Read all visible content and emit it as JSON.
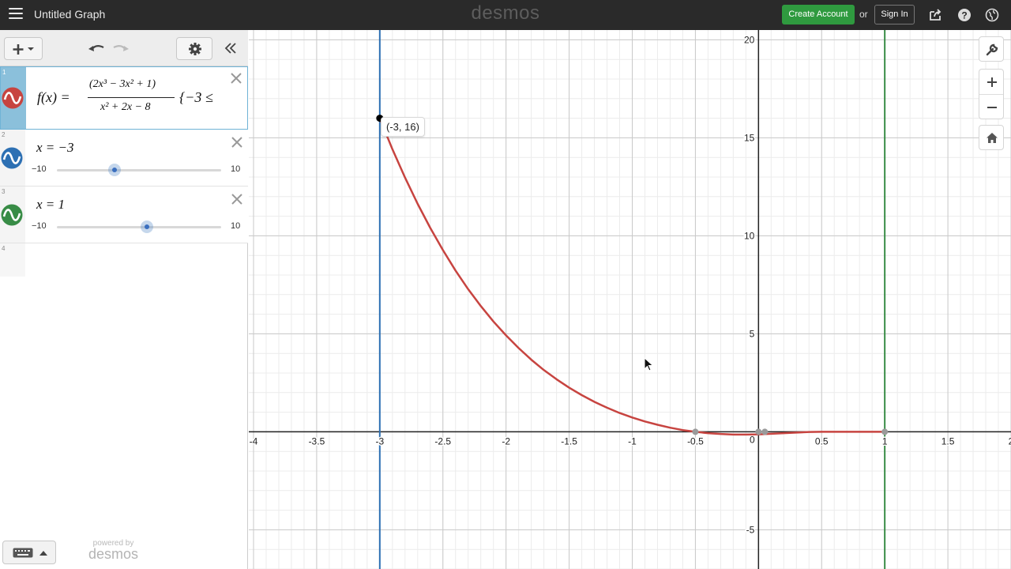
{
  "header": {
    "title": "Untitled Graph",
    "brand": "desmos",
    "create_account_label": "Create Account",
    "or_label": "or",
    "sign_in_label": "Sign In"
  },
  "expressions": [
    {
      "number": "1",
      "color": "#c74440",
      "latex_text": "f(x) = (2x³ − 3x² + 1) / (x² + 2x − 8) {−3 ≤",
      "fn_name": "f(x) =",
      "numerator": "(2x³ − 3x² + 1)",
      "denominator": "x² + 2x − 8",
      "restriction": "{−3 ≤"
    },
    {
      "number": "2",
      "color": "#2d70b3",
      "text": "x = −3",
      "slider": {
        "min_label": "−10",
        "max_label": "10",
        "min": -10,
        "max": 10,
        "value": -3
      }
    },
    {
      "number": "3",
      "color": "#388c46",
      "text": "x = 1",
      "slider": {
        "min_label": "−10",
        "max_label": "10",
        "min": -10,
        "max": 10,
        "value": 1
      }
    },
    {
      "number": "4"
    }
  ],
  "footer": {
    "powered_by": "powered by",
    "powered_brand": "desmos"
  },
  "point_label": "(-3, 16)",
  "chart_data": {
    "type": "line",
    "xlim": [
      -4,
      2
    ],
    "ylim": [
      -7,
      20.5
    ],
    "grid": true,
    "x_ticks": [
      -4,
      -3.5,
      -3,
      -2.5,
      -2,
      -1.5,
      -1,
      -0.5,
      0,
      0.5,
      1,
      1.5,
      2
    ],
    "x_tick_labels": [
      "-4",
      "-3.5",
      "-3",
      "-2.5",
      "-2",
      "-1.5",
      "-1",
      "-0.5",
      "0",
      "0.5",
      "1",
      "1.5",
      "2"
    ],
    "y_ticks": [
      -5,
      5,
      10,
      15,
      20
    ],
    "y_tick_labels": [
      "-5",
      "5",
      "10",
      "15",
      "20"
    ],
    "series": [
      {
        "color": "#c74440",
        "x": [
          -3,
          -2.9,
          -2.8,
          -2.7,
          -2.6,
          -2.5,
          -2.4,
          -2.3,
          -2.2,
          -2.1,
          -2,
          -1.9,
          -1.8,
          -1.7,
          -1.6,
          -1.5,
          -1.4,
          -1.3,
          -1.2,
          -1.1,
          -1,
          -0.9,
          -0.8,
          -0.7,
          -0.6,
          -0.5,
          -0.4,
          -0.3,
          -0.2,
          -0.1,
          0,
          0.1,
          0.2,
          0.3,
          0.4,
          0.5,
          0.6,
          0.7,
          0.8,
          0.9,
          1
        ],
        "y": [
          16,
          14.42,
          12.97,
          11.63,
          10.4,
          9.27,
          8.23,
          7.28,
          6.42,
          5.63,
          4.92,
          4.27,
          3.68,
          3.15,
          2.68,
          2.25,
          1.87,
          1.53,
          1.23,
          0.96,
          0.73,
          0.53,
          0.36,
          0.21,
          0.09,
          0.0,
          -0.07,
          -0.11,
          -0.14,
          -0.14,
          -0.13,
          -0.1,
          -0.07,
          -0.04,
          -0.01,
          0.0,
          0.0,
          0.0,
          0.0,
          0.0,
          0.0
        ]
      }
    ],
    "vertical_lines": [
      {
        "x": -3,
        "color": "#2d70b3"
      },
      {
        "x": 1,
        "color": "#388c46"
      }
    ],
    "points": [
      {
        "x": -3,
        "y": 16,
        "color": "#000000"
      },
      {
        "x": -0.5,
        "y": 0,
        "color": "#9a9a9a"
      },
      {
        "x": 0,
        "y": 0,
        "color": "#9a9a9a"
      },
      {
        "x": 0.05,
        "y": 0,
        "color": "#9a9a9a"
      },
      {
        "x": 1,
        "y": 0,
        "color": "#9a9a9a"
      }
    ]
  }
}
